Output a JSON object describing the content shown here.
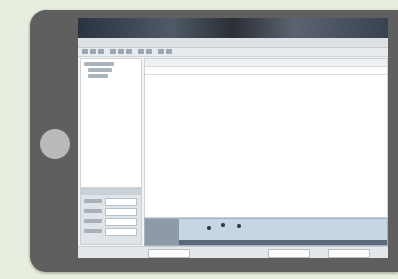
{
  "device": {
    "home_button_icon": "home-button-circle"
  },
  "app": {
    "title": "",
    "menu": [
      "",
      "",
      "",
      "",
      "",
      "",
      "",
      ""
    ],
    "toolbar_icons": [
      "new-icon",
      "open-icon",
      "save-icon",
      "cut-icon",
      "copy-icon",
      "paste-icon",
      "undo-icon",
      "redo-icon",
      "zoom-icon",
      "settings-icon"
    ]
  },
  "main_panel": {
    "tabs": [
      "",
      ""
    ],
    "columns": [
      "",
      "",
      "",
      "",
      "",
      ""
    ],
    "row": [
      "",
      "",
      "",
      "",
      "",
      ""
    ]
  },
  "properties": {
    "title": ""
  },
  "statusbar": {
    "buttons": [
      "",
      "",
      ""
    ]
  },
  "colors": {
    "tablet_frame": "#5f5f5f",
    "background": "#e6eedf",
    "timeline": "#c6d6e4"
  }
}
